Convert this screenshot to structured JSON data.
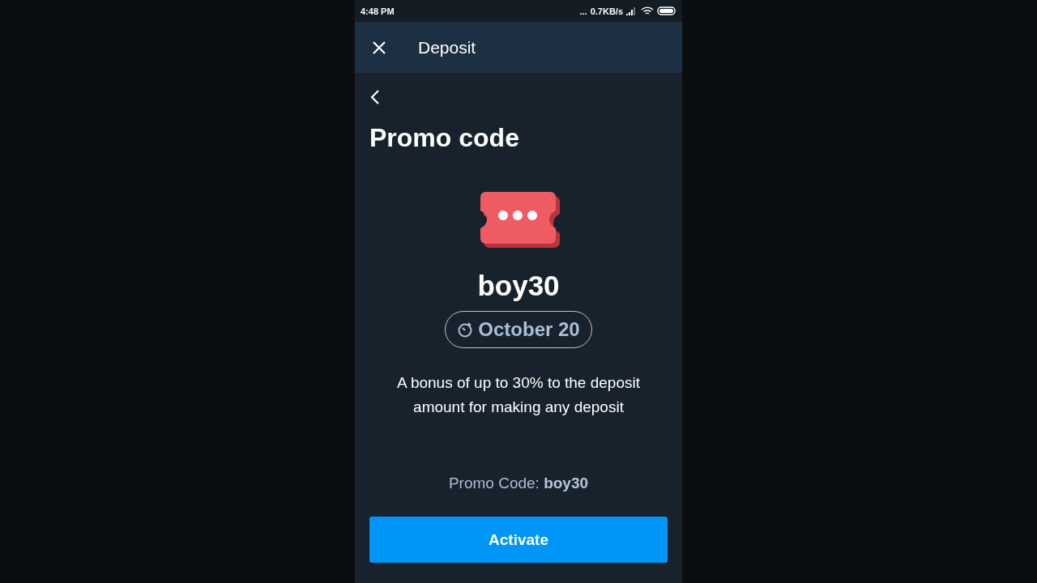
{
  "status_bar": {
    "time": "4:48 PM",
    "dots": "...",
    "speed": "0.7KB/s"
  },
  "header": {
    "title": "Deposit"
  },
  "page": {
    "title": "Promo code",
    "code": "boy30",
    "expiry": "October 20",
    "description": "A bonus of up to 30% to the deposit amount for making any deposit",
    "promo_line": "Promo Code: **boy30**"
  },
  "button": {
    "label": "Activate"
  }
}
